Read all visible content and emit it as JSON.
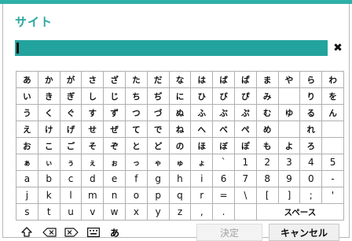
{
  "dialog": {
    "title": "サイト"
  },
  "input": {
    "value": ""
  },
  "keyboard": {
    "rows": [
      [
        "あ",
        "か",
        "が",
        "さ",
        "ざ",
        "た",
        "だ",
        "な",
        "は",
        "ば",
        "ぱ",
        "ま",
        "や",
        "ら",
        "わ"
      ],
      [
        "い",
        "き",
        "ぎ",
        "し",
        "じ",
        "ち",
        "ぢ",
        "に",
        "ひ",
        "び",
        "ぴ",
        "み",
        "",
        "り",
        "を"
      ],
      [
        "う",
        "く",
        "ぐ",
        "す",
        "ず",
        "つ",
        "づ",
        "ぬ",
        "ふ",
        "ぶ",
        "ぷ",
        "む",
        "ゆ",
        "る",
        "ん"
      ],
      [
        "え",
        "け",
        "げ",
        "せ",
        "ぜ",
        "て",
        "で",
        "ね",
        "へ",
        "べ",
        "ぺ",
        "め",
        "",
        "れ",
        ""
      ],
      [
        "お",
        "こ",
        "ご",
        "そ",
        "ぞ",
        "と",
        "ど",
        "の",
        "ほ",
        "ぼ",
        "ぽ",
        "も",
        "よ",
        "ろ",
        ""
      ],
      [
        "ぁ",
        "ぃ",
        "ぅ",
        "ぇ",
        "ぉ",
        "っ",
        "ゃ",
        "ゅ",
        "ょ",
        "`",
        "1",
        "2",
        "3",
        "4",
        "5"
      ],
      [
        "a",
        "b",
        "c",
        "d",
        "e",
        "f",
        "g",
        "h",
        "i",
        "6",
        "7",
        "8",
        "9",
        "0",
        "-"
      ],
      [
        "j",
        "k",
        "l",
        "m",
        "n",
        "o",
        "p",
        "q",
        "r",
        "=",
        "\\",
        "[",
        "]",
        ";",
        "'"
      ],
      [
        "s",
        "t",
        "u",
        "v",
        "w",
        "x",
        "y",
        "z",
        ",",
        "."
      ]
    ],
    "space_label": "スペース"
  },
  "toolbar": {
    "shift_icon": "shift-icon",
    "backspace_icon": "backspace-icon",
    "delete_icon": "delete-icon",
    "keyboard_icon": "keyboard-icon",
    "mode_label": "あ",
    "confirm_label": "決定",
    "cancel_label": "キャンセル"
  },
  "colors": {
    "accent": "#2aa7a0",
    "top_bar": "#2fb0a9"
  }
}
